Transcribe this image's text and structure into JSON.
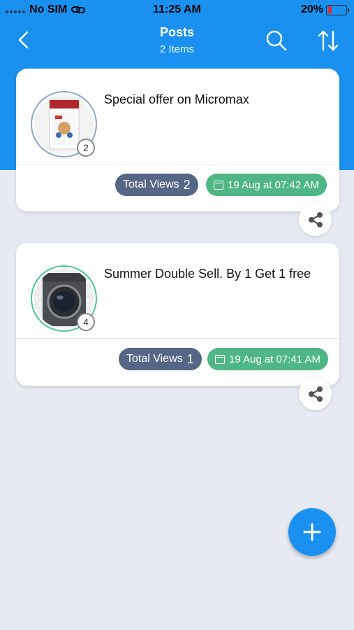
{
  "status_bar": {
    "carrier": "No SIM",
    "time": "11:25 AM",
    "battery_percent": "20%",
    "battery_level": 0.2
  },
  "nav": {
    "title": "Posts",
    "subtitle": "2 Items",
    "icons": [
      "chevron-left-icon",
      "search-icon",
      "sort-icon"
    ]
  },
  "posts": [
    {
      "title": "Special offer on Micromax",
      "image_count": "2",
      "views_label": "Total Views",
      "views_count": "2",
      "date": "19 Aug at 07:42 AM",
      "ring_color": "#8fa4d2"
    },
    {
      "title": "Summer Double Sell. By 1 Get 1 free",
      "image_count": "4",
      "views_label": "Total Views",
      "views_count": "1",
      "date": "19 Aug at 07:41 AM",
      "ring_color": "#4fc39a"
    }
  ],
  "colors": {
    "primary": "#1a91f0",
    "views_pill": "#566686",
    "date_pill": "#4fb685",
    "background": "#e8eaf3"
  }
}
